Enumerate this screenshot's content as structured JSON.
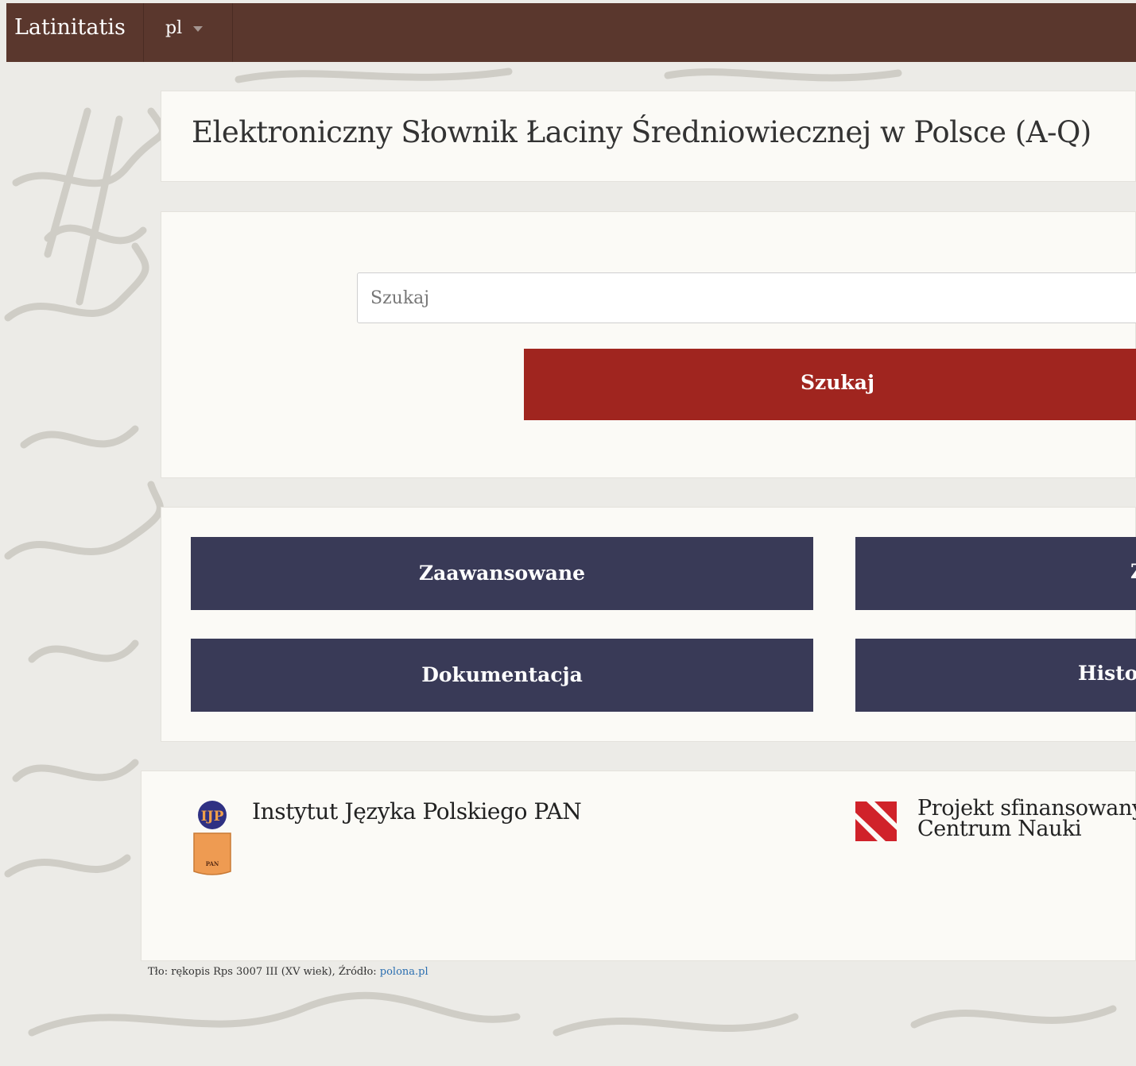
{
  "navbar": {
    "brand": "Latinitatis",
    "language": "pl",
    "colors": {
      "background": "#5a372d"
    }
  },
  "main": {
    "title": "Elektroniczny Słownik Łaciny Średniowiecznej w Polsce (A-Q)"
  },
  "search": {
    "placeholder": "Szukaj",
    "value": "",
    "button_label": "Szukaj",
    "button_color": "#a0251f"
  },
  "nav_buttons": {
    "color": "#393a57",
    "items": [
      {
        "label": "Zaawansowane"
      },
      {
        "label": "Z"
      },
      {
        "label": "Dokumentacja"
      },
      {
        "label": "Histor"
      }
    ]
  },
  "footer": {
    "ijp": {
      "name": "Instytut Języka Polskiego PAN",
      "logo_top": "IJP",
      "logo_bottom": "PAN",
      "icon": "ijp-pan-logo-icon"
    },
    "ncn": {
      "line1": "Projekt sfinansowany",
      "line2": "Centrum Nauki",
      "icon": "ncn-logo-icon",
      "color": "#d0222a"
    }
  },
  "credit": {
    "text": "Tło: rękopis Rps 3007 III (XV wiek), Źródło: ",
    "link_text": "polona.pl"
  }
}
